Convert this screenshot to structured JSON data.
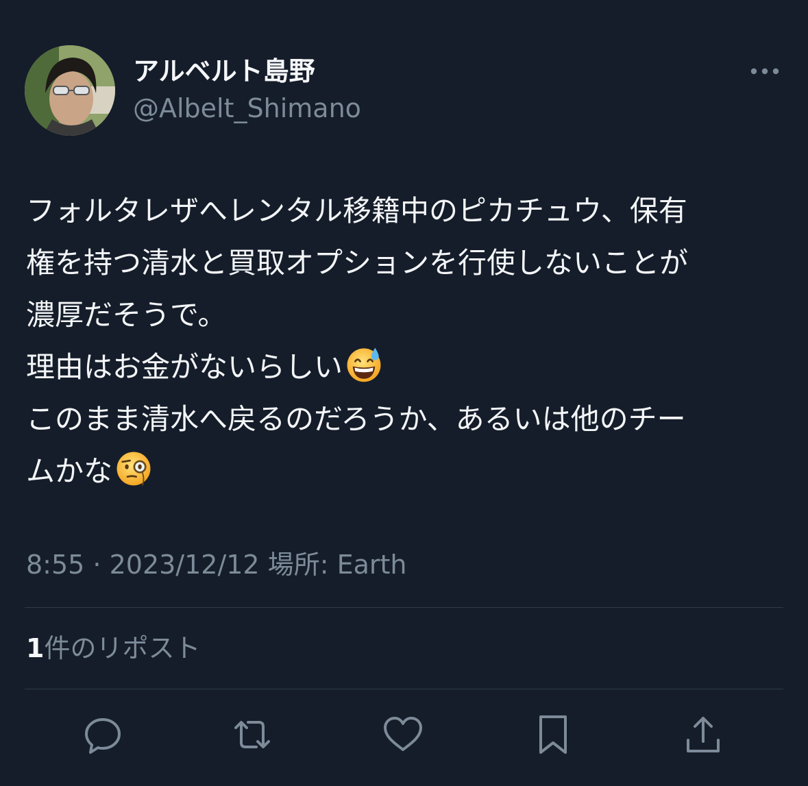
{
  "author": {
    "display_name": "アルベルト島野",
    "handle": "@Albelt_Shimano",
    "avatar_icon": "profile-photo"
  },
  "tweet": {
    "lines": [
      "フォルタレザへレンタル移籍中のピカチュウ、保有",
      "権を持つ清水と買取オプションを行使しないことが",
      "濃厚だそうで。",
      "理由はお金がないらしい",
      "このまま清水へ戻るのだろうか、あるいは他のチー",
      "ムかな"
    ],
    "emoji_1": "grinning-face-with-sweat",
    "emoji_2": "face-with-monocle"
  },
  "meta": {
    "time": "8:55",
    "separator": " · ",
    "date": "2023/12/12",
    "location_label": "場所: Earth"
  },
  "stats": {
    "repost_count": "1",
    "repost_label": "件のリポスト"
  },
  "actions": [
    "reply-icon",
    "retweet-icon",
    "like-icon",
    "bookmark-icon",
    "share-icon"
  ],
  "colors": {
    "background": "#151d2a",
    "text": "#f3f5f7",
    "secondary": "#7d8b99",
    "divider": "#2f3a47"
  }
}
